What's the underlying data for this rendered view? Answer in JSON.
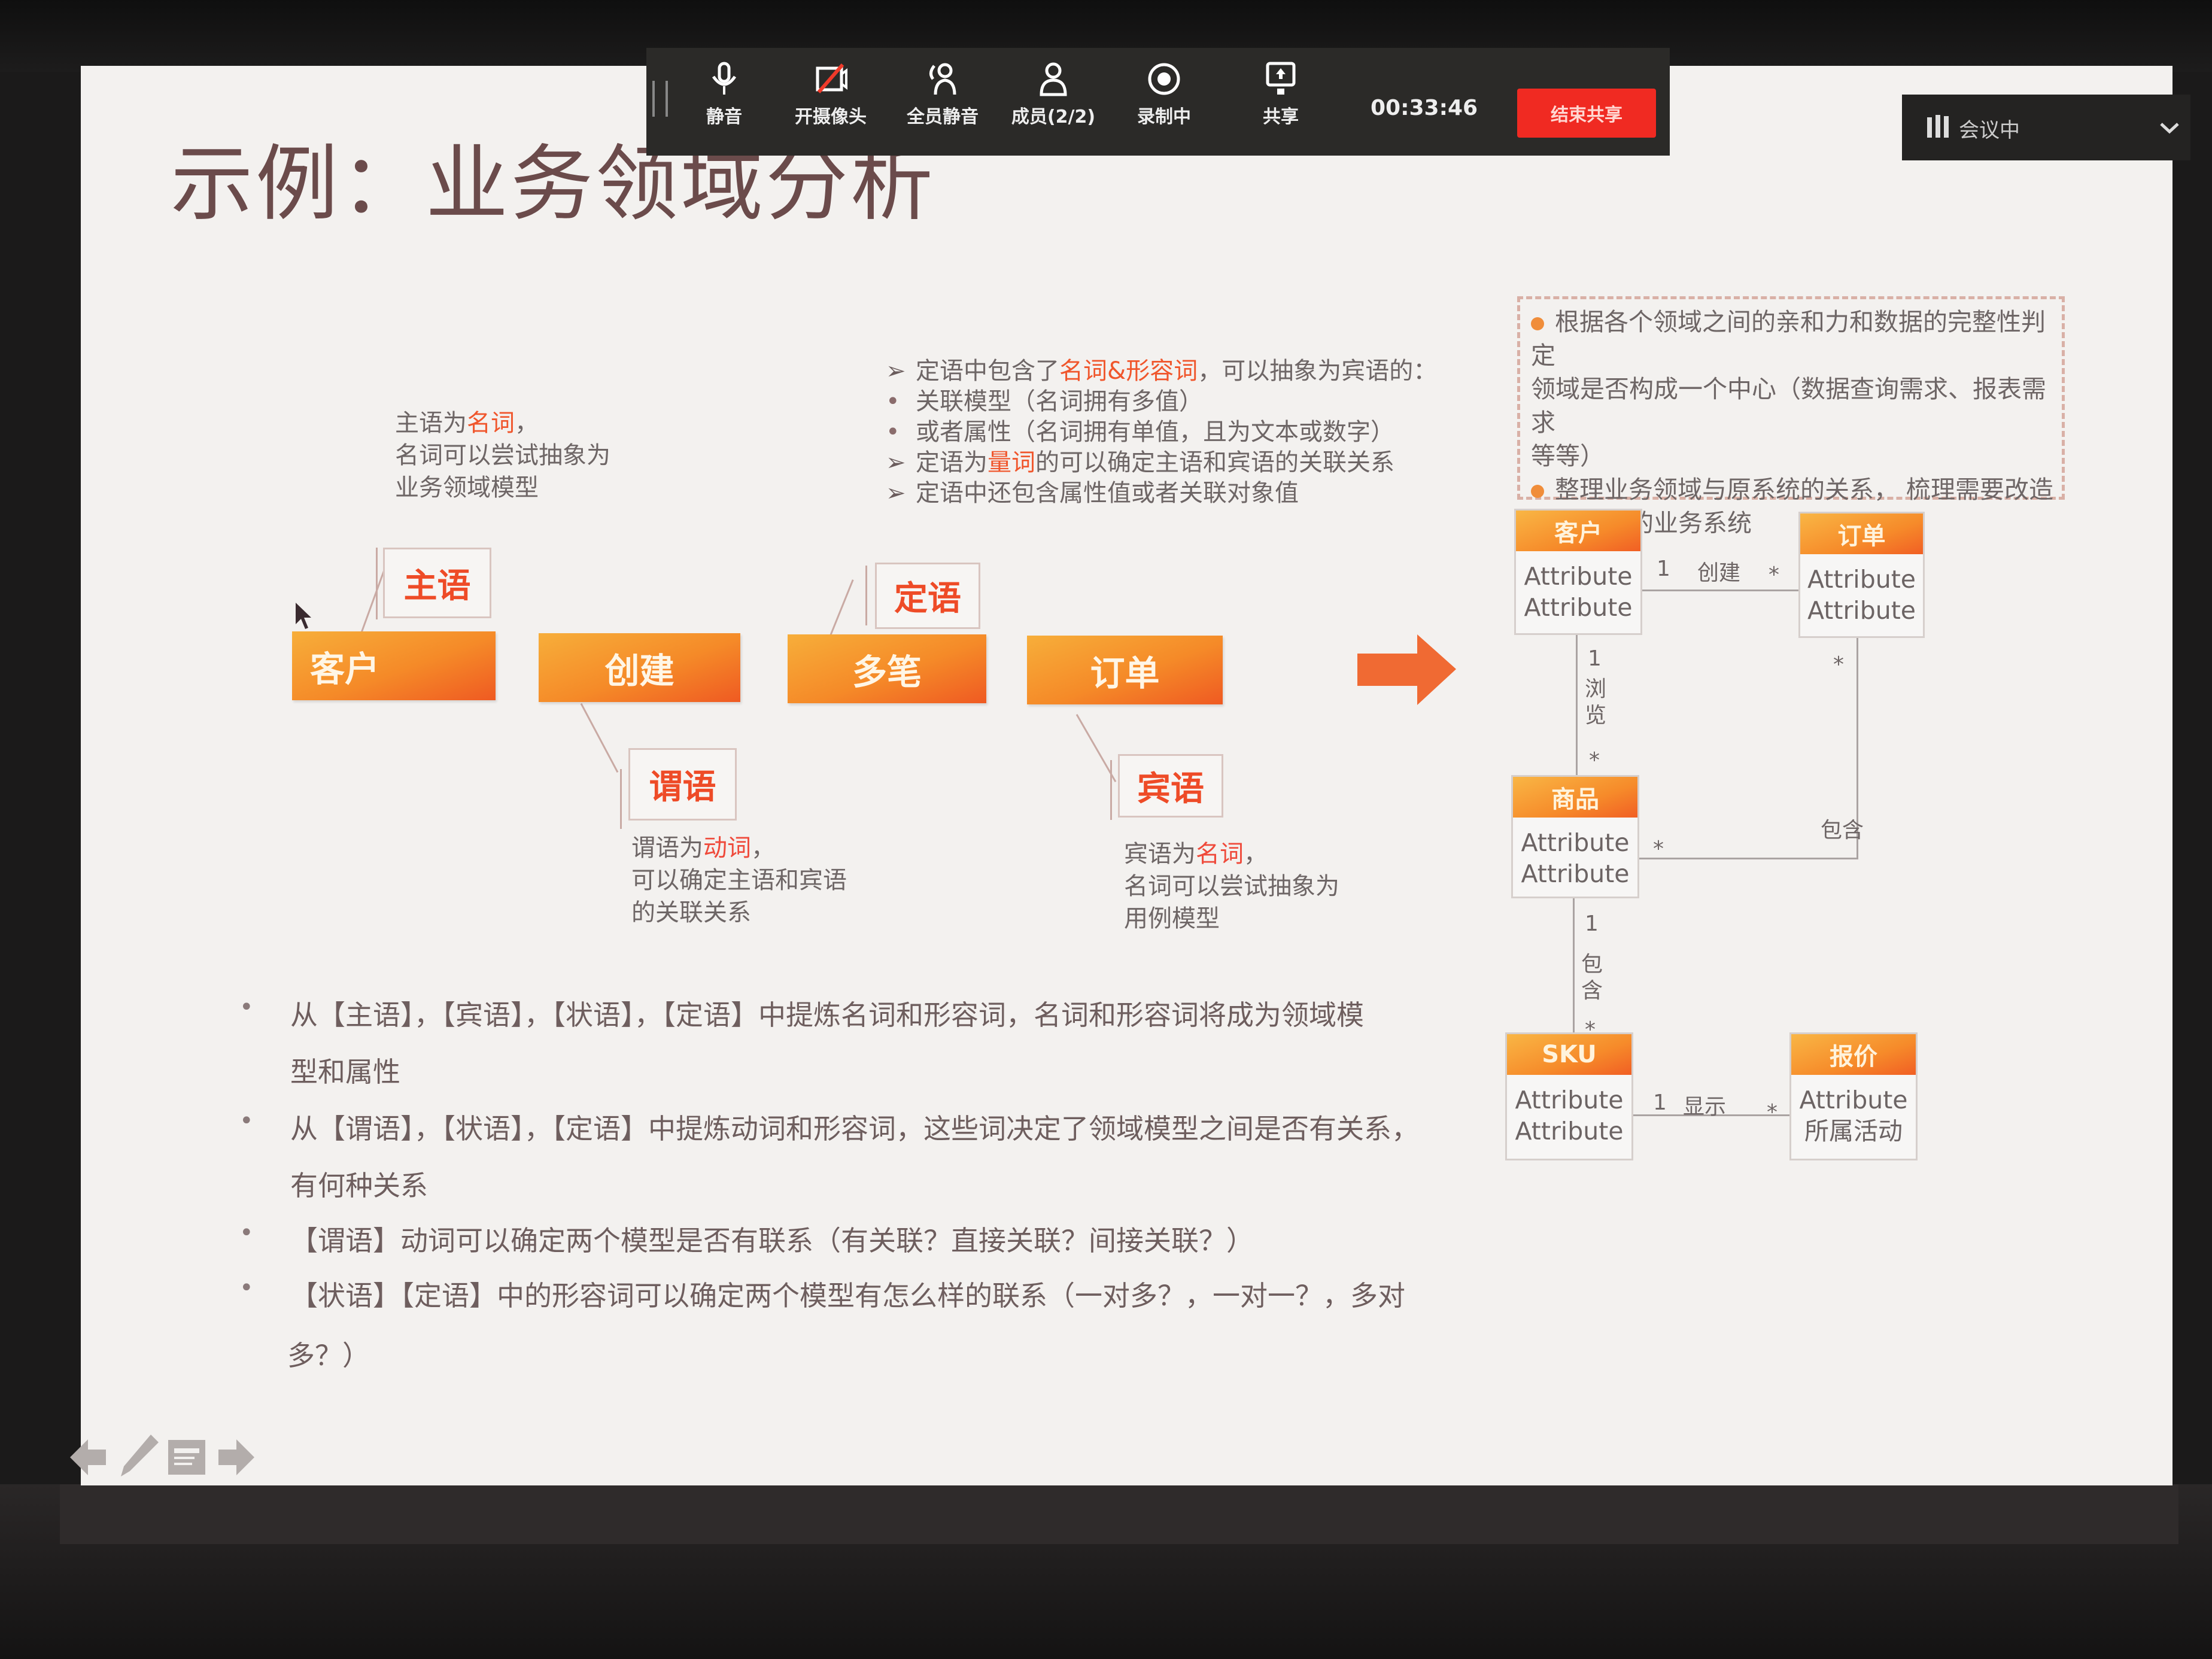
{
  "meeting_toolbar": {
    "items": [
      {
        "icon": "microphone-icon",
        "label": "静音"
      },
      {
        "icon": "camera-off-icon",
        "label": "开摄像头"
      },
      {
        "icon": "mute-all-icon",
        "label": "全员静音"
      },
      {
        "icon": "members-icon",
        "label": "成员(2/2)"
      },
      {
        "icon": "recording-icon",
        "label": "录制中"
      },
      {
        "icon": "share-screen-icon",
        "label": "共享"
      }
    ],
    "timer": "00:33:46",
    "end_share_label": "结束共享",
    "end_share_color": "#f02a22"
  },
  "meeting_status": {
    "icon": "signal-bars-icon",
    "label": "会议中",
    "dropdown_icon": "chevron-down-icon"
  },
  "slide": {
    "title": "示例：业务领域分析",
    "accent_color": "#f0562c",
    "subject_note": {
      "line1_prefix": "主语为",
      "line1_highlight": "名词",
      "line1_suffix": "，",
      "line2": "名词可以尝试抽象为",
      "line3": "业务领域模型"
    },
    "attribute_note": [
      {
        "marker": "➢",
        "prefix": "定语中包含了",
        "highlight": "名词&形容词",
        "suffix": "，可以抽象为宾语的："
      },
      {
        "marker": "•",
        "prefix": "关联模型（名词拥有多值）",
        "highlight": "",
        "suffix": ""
      },
      {
        "marker": "•",
        "prefix": "或者属性（名词拥有单值，且为文本或数字）",
        "highlight": "",
        "suffix": ""
      },
      {
        "marker": "➢",
        "prefix": "定语为",
        "highlight": "量词",
        "suffix": "的可以确定主语和宾语的关联关系"
      },
      {
        "marker": "➢",
        "prefix": "定语中还包含属性值或者关联对象值",
        "highlight": "",
        "suffix": ""
      }
    ],
    "sentence_words": [
      "客户",
      "创建",
      "多笔",
      "订单"
    ],
    "roles": {
      "subject": "主语",
      "predicate": "谓语",
      "attributive": "定语",
      "object": "宾语"
    },
    "predicate_note": {
      "line1_prefix": "谓语为",
      "line1_highlight": "动词",
      "line1_suffix": "，",
      "line2": "可以确定主语和宾语",
      "line3": "的关联关系"
    },
    "object_note": {
      "line1_prefix": "宾语为",
      "line1_highlight": "名词",
      "line1_suffix": "，",
      "line2": "名词可以尝试抽象为",
      "line3": "用例模型"
    },
    "bullets": [
      {
        "line1": "从【主语】，【宾语】，【状语】，【定语】中提炼名词和形容词，名词和形容词将成为领域模",
        "line2": "型和属性"
      },
      {
        "line1": "从【谓语】，【状语】，【定语】中提炼动词和形容词，这些词决定了领域模型之间是否有关系，",
        "line2": "有何种关系"
      },
      {
        "line1": "【谓语】动词可以确定两个模型是否有联系（有关联？直接关联？间接关联？）",
        "line2": ""
      },
      {
        "line1": "【状语】【定语】中的形容词可以确定两个模型有怎么样的联系（一对多？，一对一？，多对",
        "line2": "多？）"
      }
    ],
    "info_box": [
      {
        "line1": "根据各个领域之间的亲和力和数据的完整性判定",
        "line2": "领域是否构成一个中心（数据查询需求、报表需求",
        "line3": "等等）"
      },
      {
        "line1": "整理业务领域与原系统的关系，  梳理需要改造",
        "line2": "哪些既有的业务系统",
        "line3": ""
      }
    ],
    "uml": {
      "classes": [
        {
          "name": "客户",
          "attributes": [
            "Attribute",
            "Attribute"
          ]
        },
        {
          "name": "订单",
          "attributes": [
            "Attribute",
            "Attribute"
          ]
        },
        {
          "name": "商品",
          "attributes": [
            "Attribute",
            "Attribute"
          ]
        },
        {
          "name": "SKU",
          "attributes": [
            "Attribute",
            "Attribute"
          ]
        },
        {
          "name": "报价",
          "attributes": [
            "Attribute",
            "所属活动"
          ]
        }
      ],
      "relations": [
        {
          "from": "客户",
          "to": "订单",
          "label": "创建",
          "from_mult": "1",
          "to_mult": "*"
        },
        {
          "from": "客户",
          "to": "商品",
          "label": "浏览",
          "from_mult": "1",
          "to_mult": "*"
        },
        {
          "from": "订单",
          "to": "商品",
          "label": "包含",
          "from_mult": "*",
          "to_mult": "*"
        },
        {
          "from": "商品",
          "to": "SKU",
          "label": "包含",
          "from_mult": "1",
          "to_mult": "*"
        },
        {
          "from": "SKU",
          "to": "报价",
          "label": "显示",
          "from_mult": "1",
          "to_mult": "*"
        }
      ]
    },
    "nav_icons": [
      "previous-slide-icon",
      "pen-icon",
      "slide-menu-icon",
      "next-slide-icon"
    ]
  }
}
